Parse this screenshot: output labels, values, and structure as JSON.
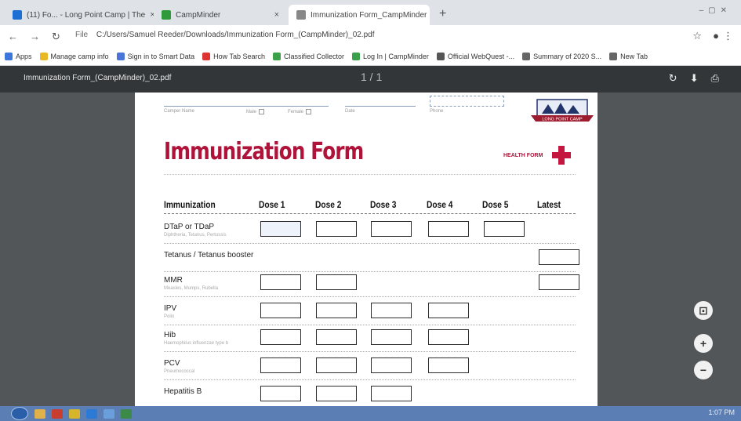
{
  "browser": {
    "tabs": [
      {
        "label": "(11) Fo... - Long Point Camp | The",
        "favicon_color": "#1d6fd4",
        "active": false
      },
      {
        "label": "CampMinder",
        "favicon_color": "#2e9a3a",
        "active": false
      },
      {
        "label": "Immunization Form_CampMinder",
        "favicon_color": "#777777",
        "active": true
      }
    ],
    "new_tab_glyph": "+",
    "url_scheme": "File",
    "url": "C:/Users/Samuel Reeder/Downloads/Immunization Form_(CampMinder)_02.pdf",
    "bookmarks": [
      {
        "label": "Apps",
        "color": "#3a77d8"
      },
      {
        "label": "Manage camp info",
        "color": "#e8b923"
      },
      {
        "label": "Sign in to Smart Data",
        "color": "#4a74d8"
      },
      {
        "label": "How Tab Search",
        "color": "#d33"
      },
      {
        "label": "Classified Collector",
        "color": "#3aa14a"
      },
      {
        "label": "Log In | CampMinder",
        "color": "#3aa14a"
      },
      {
        "label": "Official WebQuest -...",
        "color": "#555"
      },
      {
        "label": "Summary of 2020 S...",
        "color": "#666"
      },
      {
        "label": "New Tab",
        "color": "#666"
      }
    ]
  },
  "pdf": {
    "file_title": "Immunization Form_(CampMinder)_02.pdf",
    "page_indicator": "1 / 1",
    "top_fields": {
      "camper_name_label": "Camper Name",
      "male_label": "Male",
      "female_label": "Female",
      "date_label": "Date",
      "phone_label": "Phone"
    },
    "title": "Immunization Form",
    "health_label": "HEALTH FORM",
    "logo_text": "LONG POINT CAMP",
    "columns": [
      "Immunization",
      "Dose 1",
      "Dose 2",
      "Dose 3",
      "Dose 4",
      "Dose 5",
      "Latest"
    ],
    "rows": [
      {
        "label": "DTaP or TDaP",
        "sub": "Diphtheria, Tetanus, Pertussis"
      },
      {
        "label": "Tetanus / Tetanus booster",
        "sub": ""
      },
      {
        "label": "MMR",
        "sub": "Measles, Mumps, Rubella"
      },
      {
        "label": "IPV",
        "sub": "Polio"
      },
      {
        "label": "Hib",
        "sub": "Haemophilus influenzae type b"
      },
      {
        "label": "PCV",
        "sub": "Pneumococcal"
      },
      {
        "label": "Hepatitis B",
        "sub": ""
      }
    ]
  },
  "fab": {
    "fit_icon": "fit-page-icon",
    "zoom_in": "+",
    "zoom_out": "−"
  },
  "taskbar": {
    "tray_text": "1:07 PM"
  }
}
